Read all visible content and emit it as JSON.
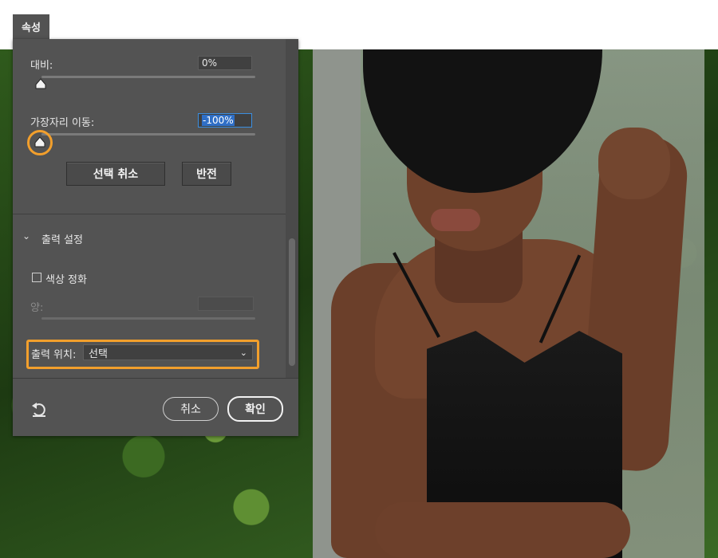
{
  "panel": {
    "tab_label": "속성",
    "contrast": {
      "label": "대비:",
      "value": "0%",
      "slider_fraction": 0.0
    },
    "shift_edge": {
      "label": "가장자리 이동:",
      "value": "-100%",
      "slider_fraction": 0.0
    },
    "buttons": {
      "clear_selection": "선택 취소",
      "invert": "반전"
    },
    "output_settings": {
      "section_title": "출력 설정",
      "decontaminate_label": "색상 정화",
      "decontaminate_checked": false,
      "amount_label": "양:",
      "output_to_label": "출력 위치:",
      "output_to_value": "선택"
    },
    "footer": {
      "cancel_label": "취소",
      "ok_label": "확인"
    }
  },
  "colors": {
    "highlight": "#f29f2c",
    "panel_bg": "#535353",
    "focus": "#3b8ee0"
  },
  "icons": [
    "chevron-down-icon",
    "reset-icon",
    "dropdown-chevron-icon"
  ]
}
